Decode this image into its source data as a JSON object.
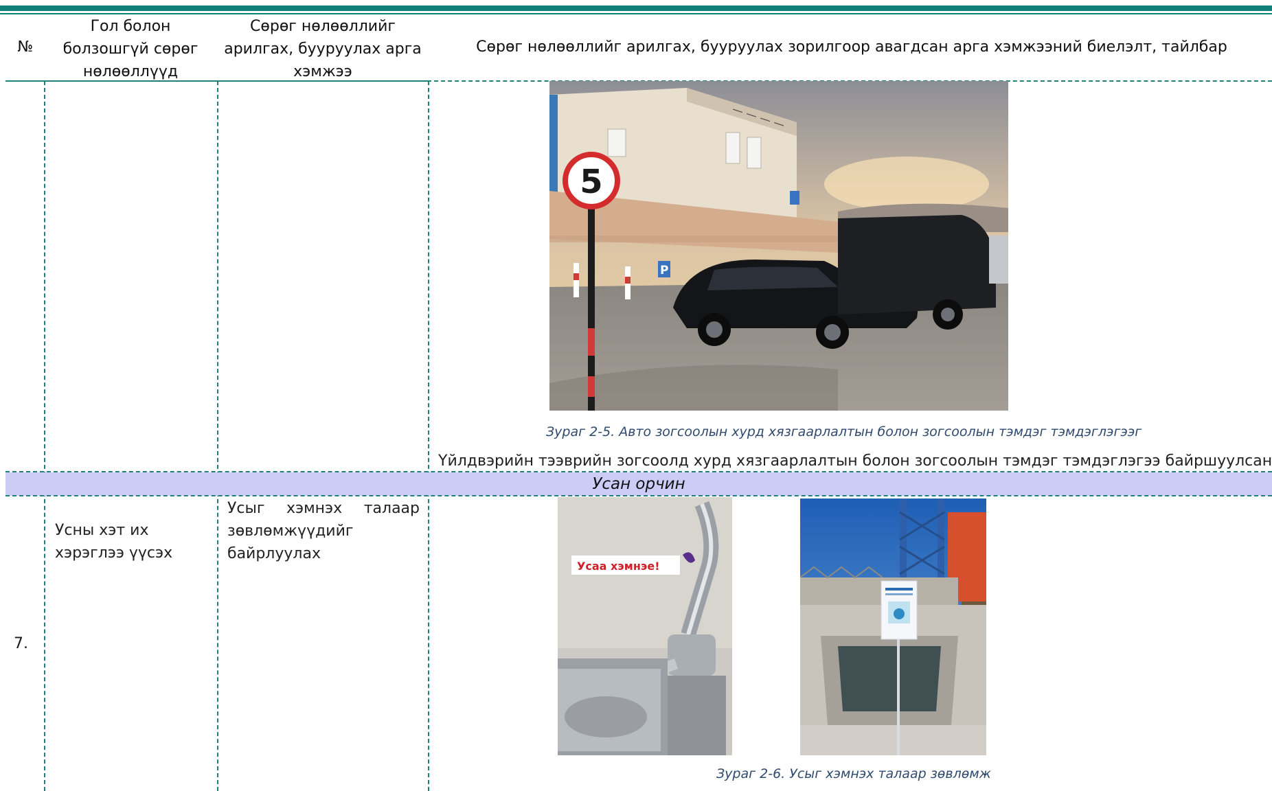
{
  "header": {
    "col_no": "№",
    "col_impact": "Гол болон болзошгүй сөрөг нөлөөллүүд",
    "col_measure": "Сөрөг нөлөөллийг арилгах, бууруулах арга хэмжээ",
    "col_result": "Сөрөг нөлөөллийг арилгах, бууруулах зорилгоор авагдсан арга хэмжээний биелэлт, тайлбар"
  },
  "row_parking": {
    "photo_sign_number": "5",
    "photo_parking_letter": "P",
    "caption": "Зураг 2-5. Авто зогсоолын хурд хязгаарлалтын болон зогсоолын  тэмдэг тэмдэглэгээг",
    "description": "Үйлдвэрийн тээврийн зогсоолд хурд хязгаарлалтын болон зогсоолын тэмдэг тэмдэглэгээ байршуулсан."
  },
  "section": {
    "label": "Усан орчин"
  },
  "row_water": {
    "number": "7.",
    "impact": "Усны хэт их хэрэглээ үүсэх",
    "measure": "Усыг хэмнэх талаар зөвлөмжүүдийг байрлуулах",
    "sticker_text": "Усаа хэмнэе!",
    "caption": "Зураг 2-6. Усыг хэмнэх талаар зөвлөмж"
  },
  "colors": {
    "accent": "#0e7f7a",
    "section_band": "#cbcdf7",
    "caption": "#2f4a6e"
  }
}
